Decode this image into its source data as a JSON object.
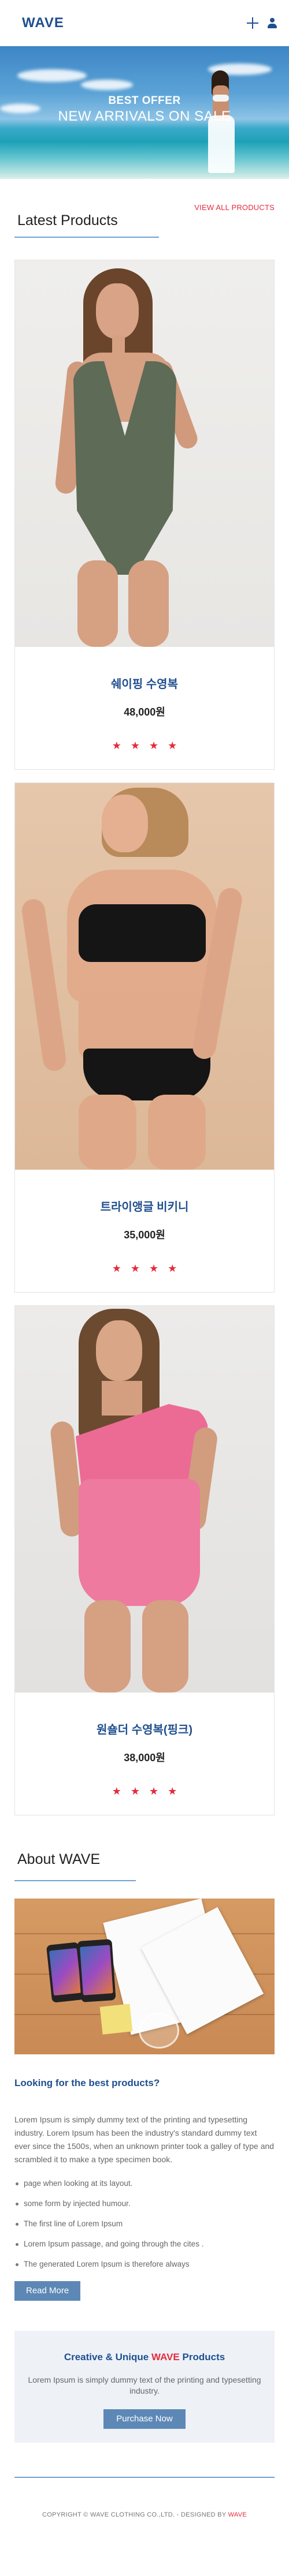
{
  "header": {
    "logo": "WAVE",
    "add_icon": "plus-icon",
    "account_icon": "user-icon"
  },
  "hero": {
    "subtitle": "BEST OFFER",
    "title": "NEW ARRIVALS ON SALE"
  },
  "latest": {
    "title": "Latest Products",
    "view_all": "VIEW ALL PRODUCTS"
  },
  "products": [
    {
      "name": "쉐이핑 수영복",
      "price": "48,000원",
      "rating": 4
    },
    {
      "name": "트라이앵글 비키니",
      "price": "35,000원",
      "rating": 4
    },
    {
      "name": "원숄더 수영복(핑크)",
      "price": "38,000원",
      "rating": 4
    }
  ],
  "about": {
    "title": "About WAVE",
    "question": "Looking for the best products?",
    "text": "Lorem Ipsum is simply dummy text of the printing and typesetting industry. Lorem Ipsum has been the industry's standard dummy text ever since the 1500s, when an unknown printer took a galley of type and scrambled it to make a type specimen book.",
    "list": [
      "page when looking at its layout.",
      "some form by injected humour.",
      "The first line of Lorem Ipsum",
      "Lorem Ipsum passage, and going through the cites .",
      "The generated Lorem Ipsum is therefore always"
    ],
    "read_more": "Read More"
  },
  "cta": {
    "title_prefix": "Creative & Unique ",
    "title_accent": "WAVE",
    "title_suffix": " Products",
    "text": "Lorem Ipsum is simply dummy text of the printing and typesetting industry.",
    "button": "Purchase Now"
  },
  "footer": {
    "copyright": "COPYRIGHT © WAVE CLOTHING CO.,LTD. - DESIGNED BY ",
    "designer": "WAVE"
  },
  "colors": {
    "brand": "#1f4f8f",
    "accent": "#e52a3a",
    "button": "#5d88b6",
    "divider": "#6fa3d6"
  }
}
